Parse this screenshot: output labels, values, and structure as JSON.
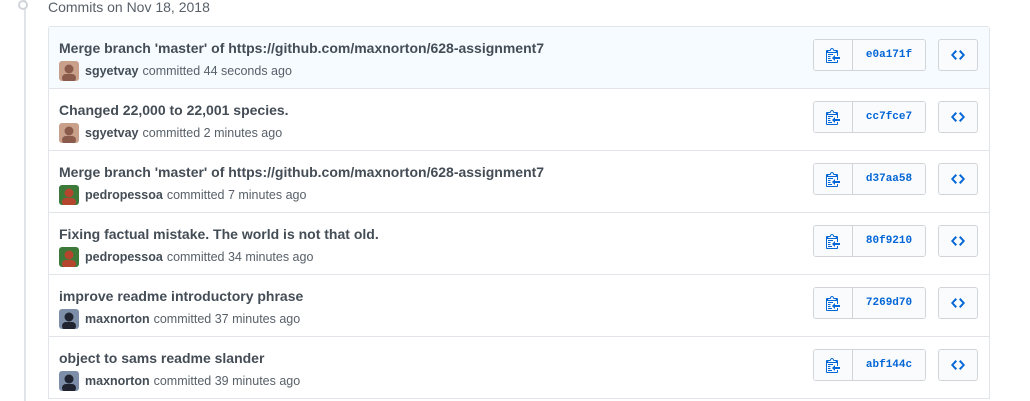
{
  "day_header": "Commits on Nov 18, 2018",
  "commits": [
    {
      "title": "Merge branch 'master' of https://github.com/maxnorton/628-assignment7",
      "author": "sgyetvay",
      "meta": "committed 44 seconds ago",
      "sha": "e0a171f",
      "avatar_color": "#8a5a4a",
      "avatar_bg": "#c9a08a"
    },
    {
      "title": "Changed 22,000 to 22,001 species.",
      "author": "sgyetvay",
      "meta": "committed 2 minutes ago",
      "sha": "cc7fce7",
      "avatar_color": "#8a5a4a",
      "avatar_bg": "#c9a08a"
    },
    {
      "title": "Merge branch 'master' of https://github.com/maxnorton/628-assignment7",
      "author": "pedropessoa",
      "meta": "committed 7 minutes ago",
      "sha": "d37aa58",
      "avatar_color": "#b4462e",
      "avatar_bg": "#3d7a3a"
    },
    {
      "title": "Fixing factual mistake. The world is not that old.",
      "author": "pedropessoa",
      "meta": "committed 34 minutes ago",
      "sha": "80f9210",
      "avatar_color": "#b4462e",
      "avatar_bg": "#3d7a3a"
    },
    {
      "title": "improve readme introductory phrase",
      "author": "maxnorton",
      "meta": "committed 37 minutes ago",
      "sha": "7269d70",
      "avatar_color": "#1f2430",
      "avatar_bg": "#7d8fa8"
    },
    {
      "title": "object to sams readme slander",
      "author": "maxnorton",
      "meta": "committed 39 minutes ago",
      "sha": "abf144c",
      "avatar_color": "#1f2430",
      "avatar_bg": "#7d8fa8"
    }
  ],
  "colors": {
    "link_blue": "#0366d6",
    "border": "#e1e4e8",
    "highlight_bg": "#f6fbff"
  },
  "icons": {
    "copy": "clippy-icon",
    "browse": "code-icon",
    "timeline": "commit-node-icon"
  }
}
